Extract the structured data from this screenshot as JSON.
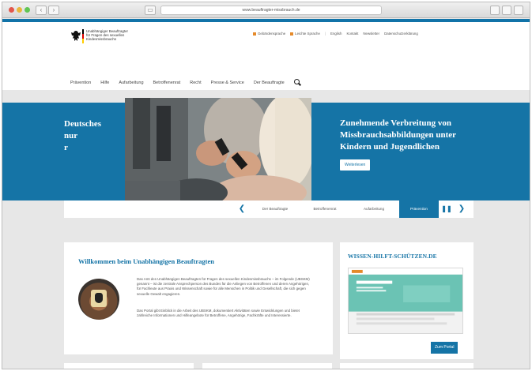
{
  "browser": {
    "url": "www.beauftragter-missbrauch.de"
  },
  "header": {
    "logo_lines": [
      "Unabhängiger Beauftragter",
      "für Fragen des sexuellen",
      "Kindesmissbrauchs"
    ],
    "service_links": [
      "Gebärdensprache",
      "Leichte Sprache",
      "English",
      "Kontakt",
      "Newsletter",
      "Datenschutzerklärung"
    ],
    "nav": [
      "Prävention",
      "Hilfe",
      "Aufarbeitung",
      "Betroffenenrat",
      "Recht",
      "Presse & Service",
      "Der Beauftragte"
    ]
  },
  "hero": {
    "left_lines": [
      "Deutsches",
      "nur",
      "r"
    ],
    "title": "Zunehmende Verbreitung von Missbrauchsabbildungen unter Kindern und Jugendlichen",
    "button": "Weiterlesen"
  },
  "slider": {
    "tabs": [
      "Der Beauftragte",
      "Betroffenenrat",
      "Aufarbeitung",
      "Prävention"
    ],
    "active_index": 3
  },
  "welcome": {
    "title": "Willkommen beim Unabhängigen Beauftragten",
    "para1": "Das Amt des Unabhängigen Beauftragten für Fragen des sexuellen Kindesmissbrauchs – im Folgende (UBSKM) genannt – ist die zentrale Ansprechperson des Bundes für die Anliegen von Betroffenen und deren Angehörigen, für Fachleute aus Praxis und Wissenschaft sowie für alle Menschen in Politik und Gesellschaft, die sich gegen sexuelle Gewalt engagieren.",
    "para2": "Das Portal gibt Einblick in die Arbeit des UBSKM, dokumentiert Aktivitäten sowie Entwicklungen und bietet zahlreiche Informationen und Hilfeangebote für Betroffene, Angehörige, Fachkräfte und Interessierte."
  },
  "side": {
    "title": "WISSEN-HILFT-SCHÜTZEN.DE",
    "shot_title": "WISSEN HILFT SCHÜTZEN",
    "button": "Zum Portal"
  }
}
